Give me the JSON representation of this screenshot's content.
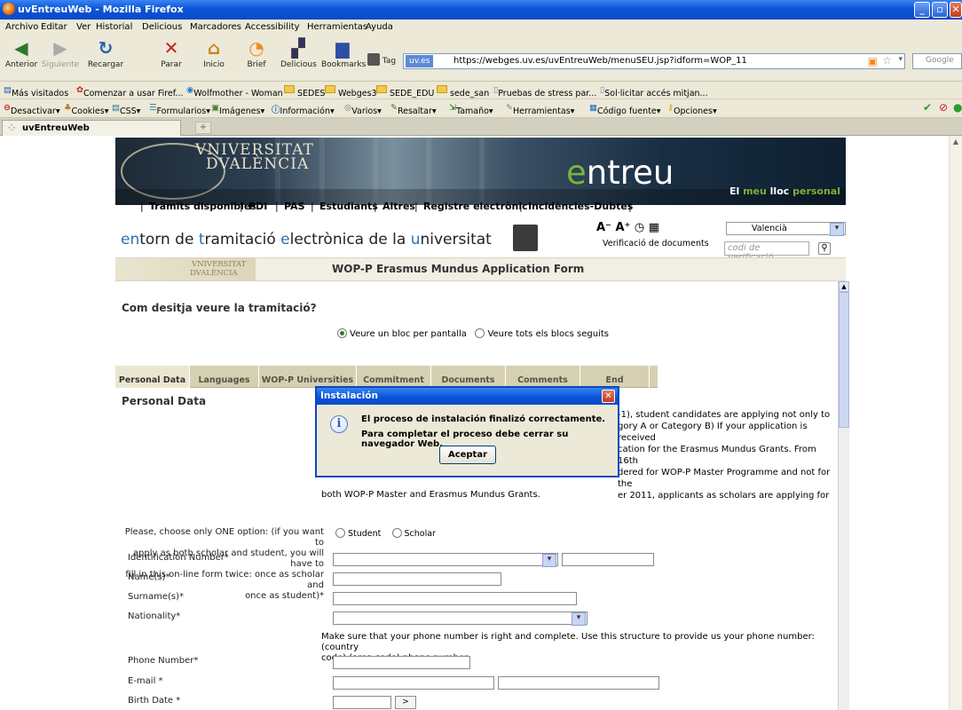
{
  "window": {
    "title": "uvEntreuWeb - Mozilla Firefox"
  },
  "menu": [
    "Archivo",
    "Editar",
    "Ver",
    "Historial",
    "Delicious",
    "Marcadores",
    "Accessibility",
    "Herramientas",
    "Ayuda"
  ],
  "nav": {
    "back": "Anterior",
    "forward": "Siguiente",
    "reload": "Recargar",
    "stop": "Parar",
    "home": "Inicio",
    "brief": "Brief",
    "delicious": "Delicious",
    "bookmarks": "Bookmarks",
    "tag": "Tag",
    "url_domain": "uv.es",
    "url": "https://webges.uv.es/uvEntreuWeb/menuSEU.jsp?idform=WOP_11",
    "search_placeholder": "Google"
  },
  "bookmarks": [
    "Más visitados",
    "Comenzar a usar Firef...",
    "Wolfmother - Woman",
    "SEDES",
    "Webges3",
    "SEDE_EDU",
    "sede_san",
    "Pruebas de stress par...",
    "Sol·licitar accés mitjan..."
  ],
  "devbar": [
    "Desactivar▾",
    "Cookies▾",
    "CSS▾",
    "Formularios▾",
    "Imágenes▾",
    "Información▾",
    "Varios▾",
    "Resaltar▾",
    "Tamaño▾",
    "Herramientas▾",
    "Código fuente▾",
    "Opciones▾"
  ],
  "tab": {
    "title": "uvEntreuWeb",
    "new": "+"
  },
  "banner": {
    "univ_line1": "VNIVERSITAT",
    "univ_line2": "DVALÈNCIA",
    "brand_e": "e",
    "brand_rest": "ntreu",
    "slogan_a": "El ",
    "slogan_b": "meu ",
    "slogan_c": "lloc ",
    "slogan_d": "personal"
  },
  "topnav": [
    "Tràmits disponibles",
    "PDI",
    "PAS",
    "Estudiants",
    "Altres",
    "Registre electrònic",
    "Incidències-Dubtes"
  ],
  "subhead": {
    "t1": "en",
    "t2": "torn de ",
    "t3": "t",
    "t4": "ramitació ",
    "t5": "e",
    "t6": "lectrònica de la ",
    "t7": "u",
    "t8": "niversitat",
    "font_controls": "A⁻ A⁺ ◷ ▦",
    "verif_label": "Verificació de documents",
    "language": "Valencià",
    "code_placeholder": "codi de verificació"
  },
  "form": {
    "univ_small_1": "VNIVERSITAT",
    "univ_small_2": "DVALÈNCIA",
    "title": "WOP-P Erasmus Mundus Application Form",
    "question": "Com desitja veure la tramitació?",
    "view_opt1": "Veure un bloc per pantalla",
    "view_opt2": "Veure tots els blocs seguits",
    "view_selected": "Veure un bloc per pantalla",
    "tabs": [
      "Personal Data",
      "Languages",
      "WOP-P Universities",
      "Commitment",
      "Documents",
      "Comments",
      "End"
    ],
    "active_tab": "Personal Data",
    "section_title": "Personal Data",
    "intro_lines": [
      "-1), student candidates are applying not only to",
      "gory A or Category B) If your application is received",
      "cation for the Erasmus Mundus Grants. From 16th",
      "dered for WOP-P Master Programme and not for the",
      "er 2011, applicants as scholars are applying for"
    ],
    "intro_last": "both WOP-P Master and Erasmus Mundus Grants.",
    "choose_label_lines": [
      "Please, choose only ONE option: (if you want to",
      "apply as both scholar and student, you will have to",
      "fill in this on-line form twice: once as scholar and",
      "once as student)*"
    ],
    "opt_student": "Student",
    "opt_scholar": "Scholar",
    "fields": {
      "identification": "Identification Number*",
      "names": "Name(s)*",
      "surnames": "Surname(s)*",
      "nationality": "Nationality*",
      "phone_hint_1": "Make sure that your phone number is right and complete. Use this structure to provide us your phone number: (country",
      "phone_hint_2": "code) (area code) phone number",
      "phone": "Phone Number*",
      "email": "E-mail *",
      "birth": "Birth Date *",
      "birth_btn": ">"
    }
  },
  "dialog": {
    "title": "Instalación",
    "close": "✕",
    "msg1": "El proceso de instalación finalizó correctamente.",
    "msg2": "Para completar el proceso debe cerrar su navegador Web.",
    "ok": "Aceptar"
  }
}
